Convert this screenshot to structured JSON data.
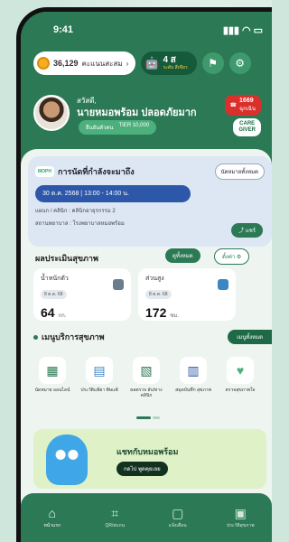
{
  "status": {
    "time": "9:41"
  },
  "topbar": {
    "coins": "36,129",
    "coin_label": "คะแนนสะสม",
    "level": "4 ส",
    "level_sub": "ระดับ สีเขียว"
  },
  "profile": {
    "greeting": "สวัสดี,",
    "name": "นายหมอพร้อม ปลอดภัยมาก",
    "badge_label": "ยืนยันตัวตน",
    "badge_code": "TIER 10,000",
    "sos_label": "1669",
    "sos_sub": "ฉุกเฉิน",
    "caregiver_line1": "CARE",
    "caregiver_line2": "GIVER"
  },
  "appointment": {
    "org": "MOPH",
    "title": "การนัดที่กำลังจะมาถึง",
    "view_all": "นัดหมายทั้งหมด",
    "date": "30 ต.ค. 2568 | 13:00 - 14:00 น.",
    "clinic": "แผนก / คลินิก : คลินิกอายุรกรรม 2",
    "place": "สถานพยาบาล : โรงพยาบาลหมอพร้อม",
    "share": "แชร์"
  },
  "assessment": {
    "title": "ผลประเมินสุขภาพ",
    "see_all": "ดูทั้งหมด",
    "settings": "ตั้งค่า",
    "metrics": [
      {
        "label": "น้ำหนักตัว",
        "date": "8 ต.ค. 68",
        "value": "64",
        "unit": "กก."
      },
      {
        "label": "ส่วนสูง",
        "date": "8 ต.ค. 68",
        "value": "172",
        "unit": "ซม."
      }
    ]
  },
  "services": {
    "title": "เมนูบริการสุขภาพ",
    "view_all": "เมนูทั้งหมด",
    "items": [
      {
        "label": "นัดหมาย ออนไลน์",
        "icon": "calendar-icon"
      },
      {
        "label": "ประวัติแพ้ยา พิษแพ้",
        "icon": "card-icon"
      },
      {
        "label": "ผลตรวจ ลับ/ทางคลินิก",
        "icon": "document-icon"
      },
      {
        "label": "สมุดบันทึก สุขภาพ",
        "icon": "book-icon"
      },
      {
        "label": "ตรวจสุขภาพใจ",
        "icon": "heart-chat-icon"
      }
    ]
  },
  "banner": {
    "title": "แชทกับหมอพร้อม",
    "button": "กดไป พูดคุยเลย"
  },
  "tabs": [
    {
      "label": "หน้าแรก",
      "icon": "home-icon"
    },
    {
      "label": "QR/สแกน",
      "icon": "qr-icon"
    },
    {
      "label": "แจ้งเตือน",
      "icon": "chat-icon"
    },
    {
      "label": "ประวัติสุขภาพ",
      "icon": "record-icon"
    }
  ],
  "colors": {
    "primary": "#2c7a55",
    "accent_blue": "#2d57a8",
    "sos": "#d9302c",
    "coin": "#f2b01e"
  }
}
